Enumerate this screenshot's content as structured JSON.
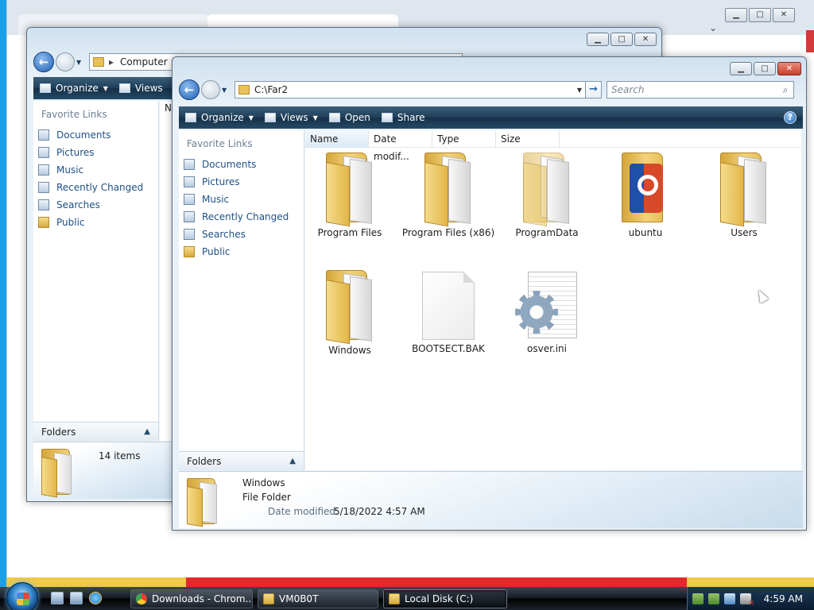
{
  "background_browser": {
    "tab1_title": "",
    "tab2_title": ""
  },
  "back_window": {
    "address": "Computer",
    "toolbar": {
      "organize": "Organize",
      "views": "Views"
    },
    "favorite_links_header": "Favorite Links",
    "links": [
      "Documents",
      "Pictures",
      "Music",
      "Recently Changed",
      "Searches",
      "Public"
    ],
    "column_partial": "N",
    "folders_label": "Folders",
    "status": "14 items"
  },
  "front_window": {
    "address": "C:\\Far2",
    "search_placeholder": "Search",
    "toolbar": {
      "organize": "Organize",
      "views": "Views",
      "open": "Open",
      "share": "Share"
    },
    "favorite_links_header": "Favorite Links",
    "links": [
      "Documents",
      "Pictures",
      "Music",
      "Recently Changed",
      "Searches",
      "Public"
    ],
    "folders_label": "Folders",
    "columns": [
      "Name",
      "Date modif...",
      "Type",
      "Size"
    ],
    "items": [
      {
        "name": "Program Files",
        "icon": "folder-icon"
      },
      {
        "name": "Program Files (x86)",
        "icon": "folder-icon"
      },
      {
        "name": "ProgramData",
        "icon": "folder-icon"
      },
      {
        "name": "ubuntu",
        "icon": "ubuntu-folder-icon"
      },
      {
        "name": "Users",
        "icon": "folder-icon"
      },
      {
        "name": "Windows",
        "icon": "folder-icon"
      },
      {
        "name": "BOOTSECT.BAK",
        "icon": "file-icon"
      },
      {
        "name": "osver.ini",
        "icon": "settings-file-icon"
      }
    ],
    "details": {
      "name": "Windows",
      "type": "File Folder",
      "date_label": "Date modified:",
      "date_value": "5/18/2022 4:57 AM"
    }
  },
  "taskbar": {
    "tasks": [
      {
        "label": "Downloads - Chrom...",
        "icon": "chrome-icon"
      },
      {
        "label": "VM0B0T",
        "icon": "folder-icon"
      },
      {
        "label": "Local Disk (C:)",
        "icon": "drive-icon"
      }
    ],
    "clock": "4:59 AM"
  }
}
